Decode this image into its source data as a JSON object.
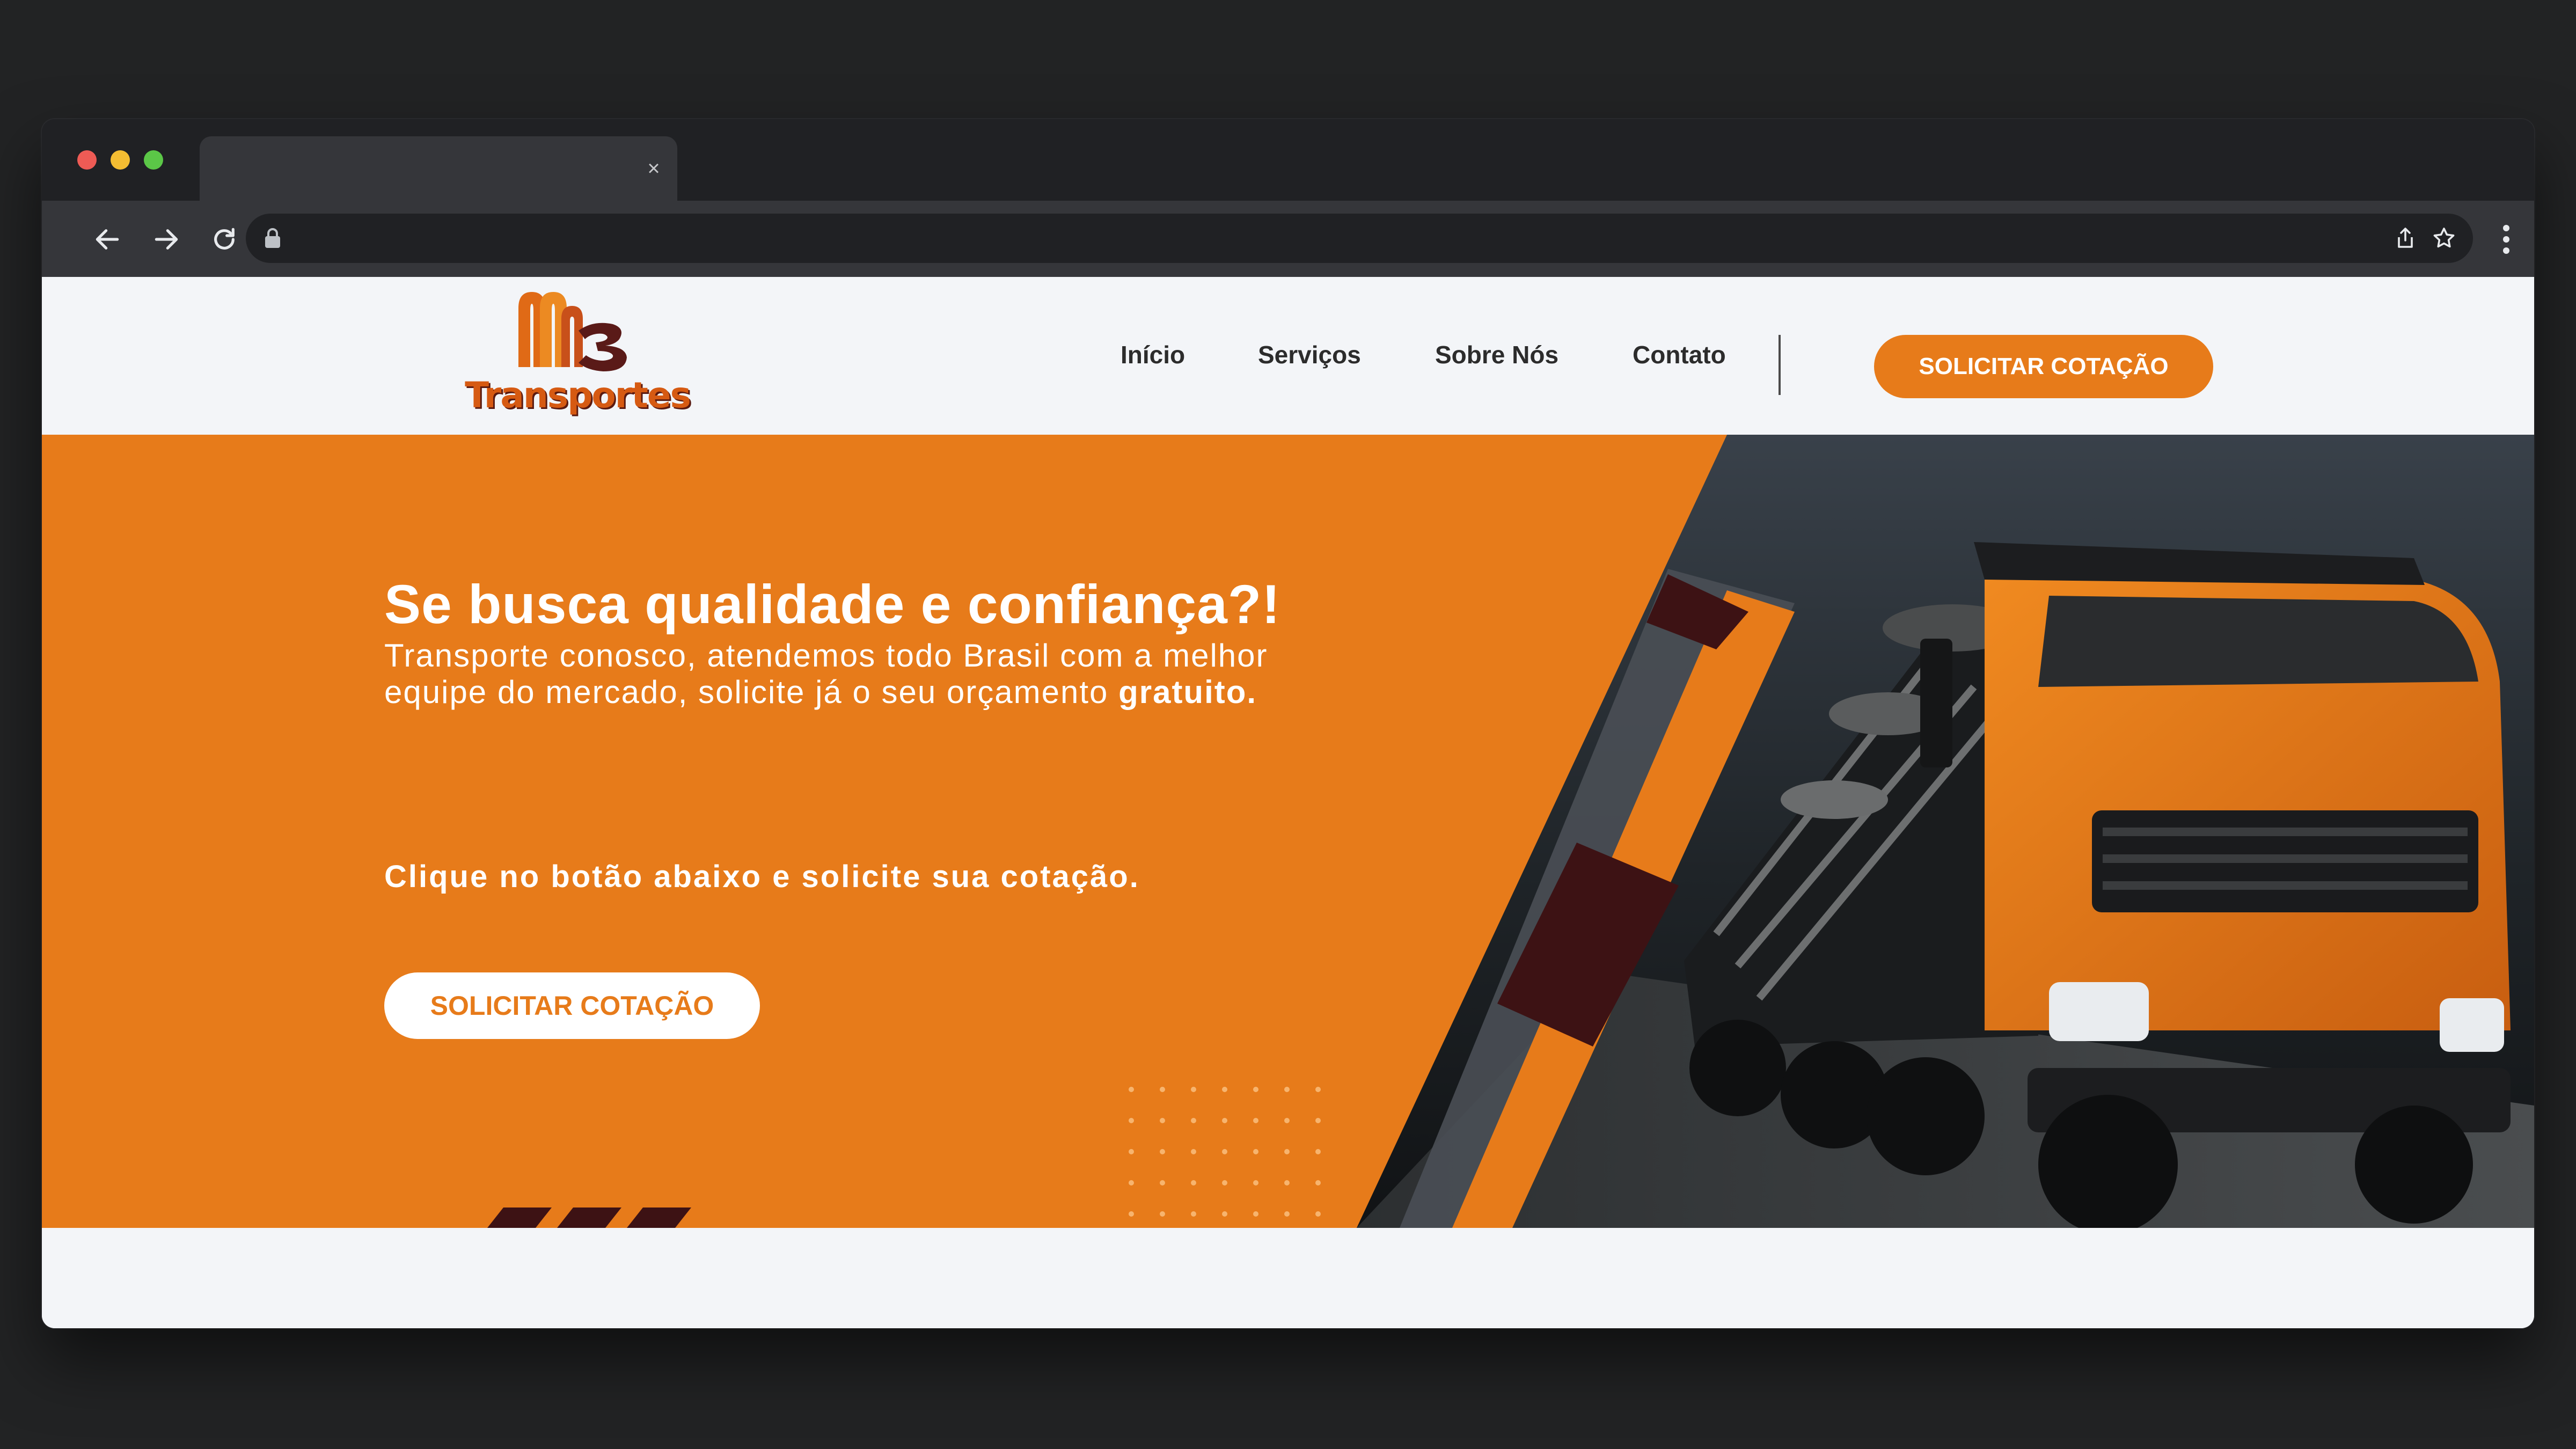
{
  "browser": {
    "tab_close": "×"
  },
  "header": {
    "logo_text": "Transportes",
    "nav": [
      {
        "label": "Início"
      },
      {
        "label": "Serviços"
      },
      {
        "label": "Sobre Nós"
      },
      {
        "label": "Contato"
      }
    ],
    "cta_label": "SOLICITAR COTAÇÃO"
  },
  "hero": {
    "title": "Se busca qualidade e confiança?!",
    "subtitle": "Transporte conosco, atendemos todo Brasil com a melhor equipe do mercado, solicite já o seu orçamento",
    "subtitle_bold": "gratuito.",
    "cta_text": "Clique no botão abaixo e solicite sua cotação.",
    "button_label": "SOLICITAR COTAÇÃO"
  },
  "colors": {
    "brand_orange": "#e77b1a",
    "dark_maroon": "#3d1214",
    "page_bg": "#f3f5f8",
    "browser_chrome": "#35363a"
  },
  "icons": [
    "back-arrow-icon",
    "forward-arrow-icon",
    "reload-icon",
    "lock-icon",
    "share-icon",
    "star-icon",
    "more-menu-icon",
    "close-icon"
  ]
}
